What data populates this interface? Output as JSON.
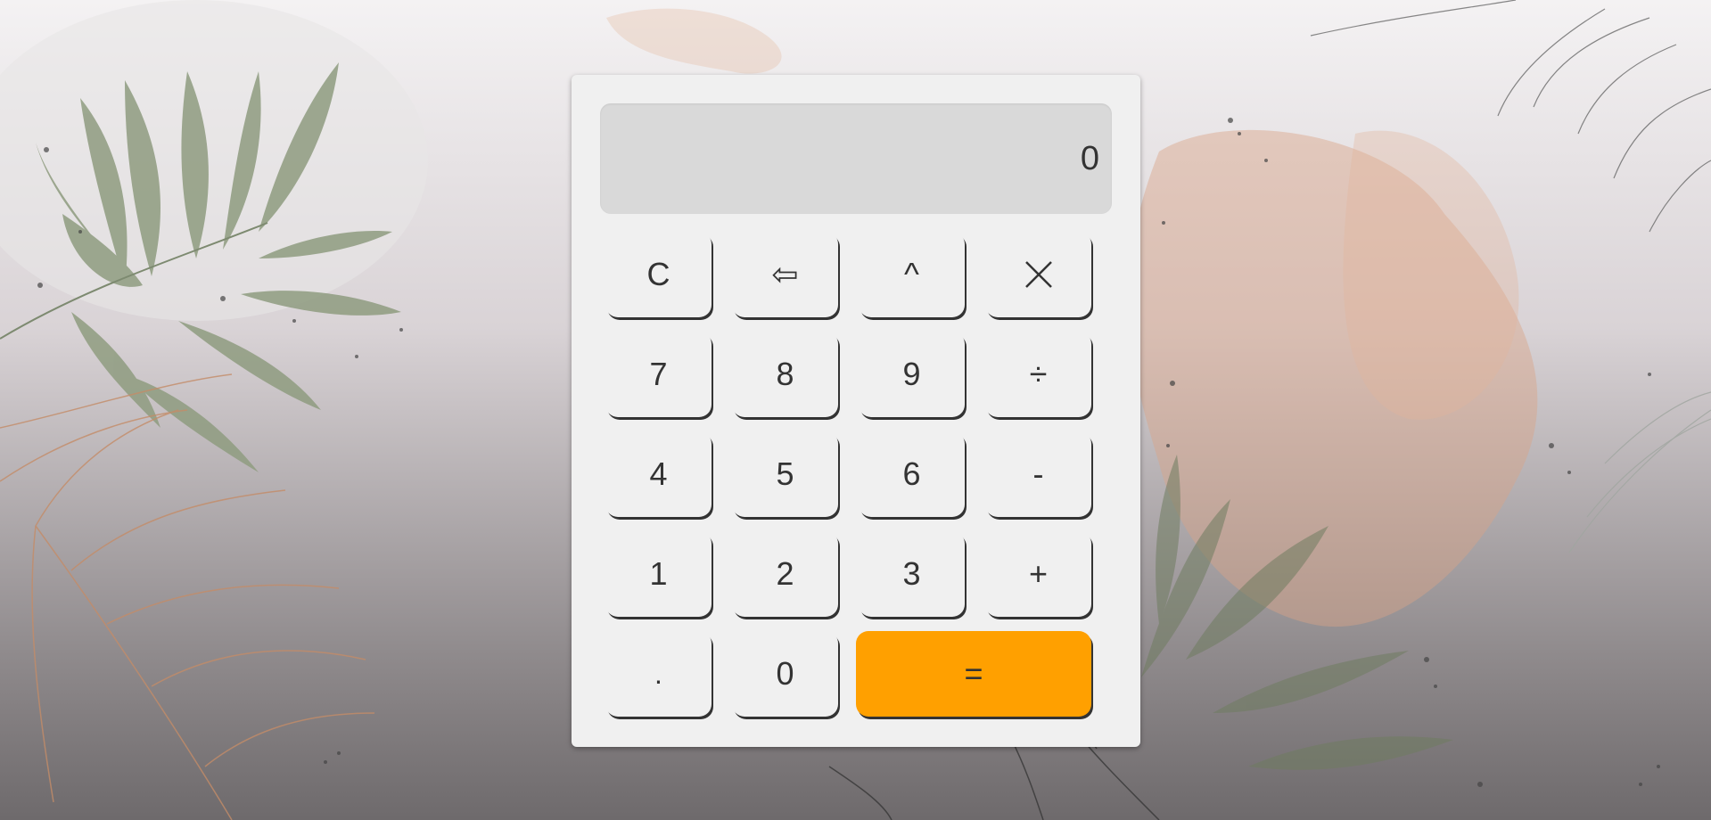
{
  "display": {
    "value": "0"
  },
  "keys": {
    "clear": "C",
    "backspace": "⇦",
    "power": "^",
    "multiply": "×",
    "seven": "7",
    "eight": "8",
    "nine": "9",
    "divide": "÷",
    "four": "4",
    "five": "5",
    "six": "6",
    "subtract": "-",
    "one": "1",
    "two": "2",
    "three": "3",
    "add": "+",
    "decimal": ".",
    "zero": "0",
    "equals": "="
  },
  "colors": {
    "panel": "#f0f0f0",
    "display": "#d9d9d9",
    "equals_button": "#ffa000",
    "text": "#333333"
  }
}
